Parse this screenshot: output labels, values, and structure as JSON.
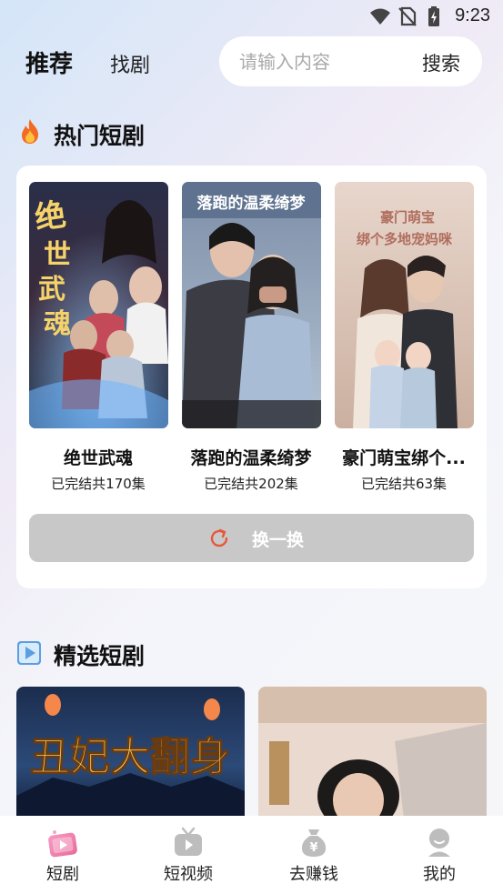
{
  "status_bar": {
    "time": "9:23"
  },
  "header": {
    "tabs": [
      {
        "label": "推荐",
        "active": true
      },
      {
        "label": "找剧",
        "active": false
      }
    ],
    "search": {
      "placeholder": "请输入内容",
      "button_label": "搜索"
    }
  },
  "hot_section": {
    "title": "热门短剧",
    "icon": "fire-icon",
    "items": [
      {
        "title": "绝世武魂",
        "status": "已完结共170集",
        "poster_text": "绝世武魂"
      },
      {
        "title": "落跑的温柔绮梦",
        "status": "已完结共202集",
        "poster_text": "落跑的温柔绮梦"
      },
      {
        "title": "豪门萌宝绑个...",
        "status": "已完结共63集",
        "poster_text": "豪门萌宝 绑个多地宠妈咪"
      }
    ],
    "refresh_label": "换一换"
  },
  "featured_section": {
    "title": "精选短剧",
    "icon": "play-square-icon",
    "items": [
      {
        "poster_text": "丑妃大翻身"
      },
      {
        "poster_text": ""
      }
    ]
  },
  "bottom_nav": [
    {
      "label": "短剧",
      "icon": "drama-icon",
      "active": true
    },
    {
      "label": "短视频",
      "icon": "tv-icon",
      "active": false
    },
    {
      "label": "去赚钱",
      "icon": "money-bag-icon",
      "active": false
    },
    {
      "label": "我的",
      "icon": "user-icon",
      "active": false
    }
  ],
  "colors": {
    "accent": "#e8573a",
    "refresh_bg": "#c8c8c8",
    "nav_active": "#f07aa8"
  }
}
